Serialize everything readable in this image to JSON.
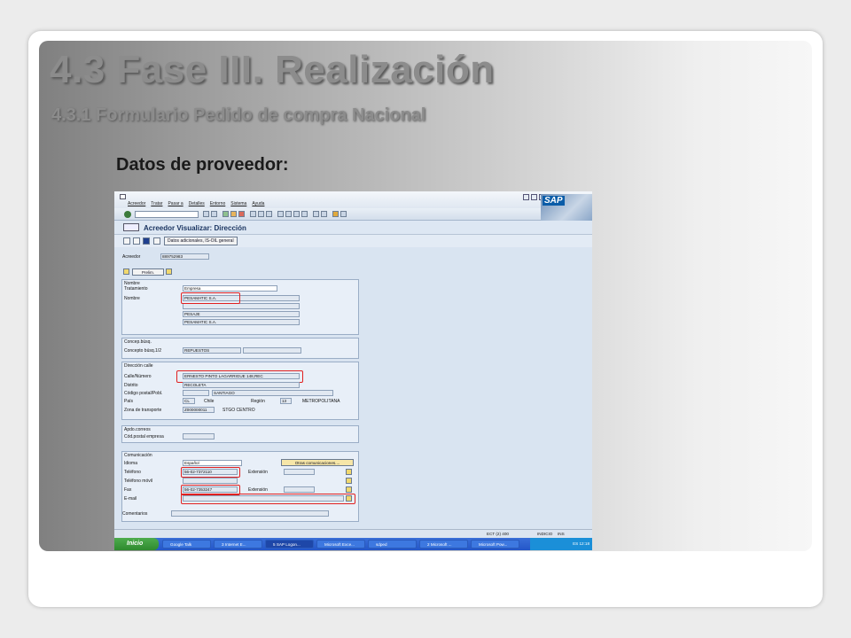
{
  "slide": {
    "title": "4.3 Fase III. Realización",
    "subtitle": "4.3.1 Formulario Pedido de compra Nacional",
    "section_label": "Datos de proveedor:"
  },
  "sap": {
    "menu": [
      "Acreedor",
      "Tratar",
      "Pasar a",
      "Detalles",
      "Entorno",
      "Sistema",
      "Ayuda"
    ],
    "logo": "SAP",
    "screen_title": "Acreedor Visualizar: Dirección",
    "app_button": "Datos adicionales, IS-OIL general",
    "acreedor_label": "Acreedor",
    "acreedor_value": "889752983",
    "prelim_button": "Prelim.",
    "nombre": {
      "group": "Nombre",
      "tratamiento_label": "Tratamiento",
      "tratamiento_value": "Empresa",
      "nombre_label": "Nombre",
      "nombre_value": "PESAMATIC S.A.",
      "line3": "PESAJE",
      "line4": "PESAMATIC S.A."
    },
    "concepto": {
      "group": "Concep.búsq.",
      "label": "Concepto búsq.1/2",
      "value": "REPUESTOS"
    },
    "direccion": {
      "group": "Dirección calle",
      "calle_label": "Calle/Número",
      "calle_value": "ERNESTO PINTO LAGARRIGUE 148,REC",
      "distrito_label": "Distrito",
      "distrito_value": "RECOLETA",
      "cp_label": "Código postal/Pobl.",
      "cp_value": "SANTIAGO",
      "pais_label": "País",
      "pais_code": "CL",
      "pais_name": "Chile",
      "region_label": "Región",
      "region_code": "13",
      "region_name": "METROPOLITANA",
      "zona_label": "Zona de transporte",
      "zona_code": "Z000000011",
      "zona_name": "STGO CENTRO"
    },
    "apdo": {
      "group": "Apdo.correos",
      "label": "Cód.postal empresa"
    },
    "comunicacion": {
      "group": "Comunicación",
      "idioma_label": "Idioma",
      "idioma_value": "Español",
      "otras_button": "Otras comunicaciones....",
      "telefono_label": "Teléfono",
      "telefono_value": "56-02-7372110",
      "extension_label": "Extensión",
      "movil_label": "Teléfono móvil",
      "fax_label": "Fax",
      "fax_value": "56-02-7353247",
      "extension2_label": "Extensión",
      "email_label": "E-mail"
    },
    "comentarios_label": "Comentarios",
    "status": {
      "system": "ECT (2) 400",
      "server": "INDICIO",
      "mode": "INS"
    },
    "taskbar": {
      "start": "Inicio",
      "tasks": [
        "Google Talk",
        "3 Internet E...",
        "5 SAP Logon...",
        "Microsoft Exce...",
        "sdped",
        "2 Microsoft ...",
        "Microsoft Pow..."
      ],
      "lang": "ES",
      "clock": "12:18"
    }
  }
}
